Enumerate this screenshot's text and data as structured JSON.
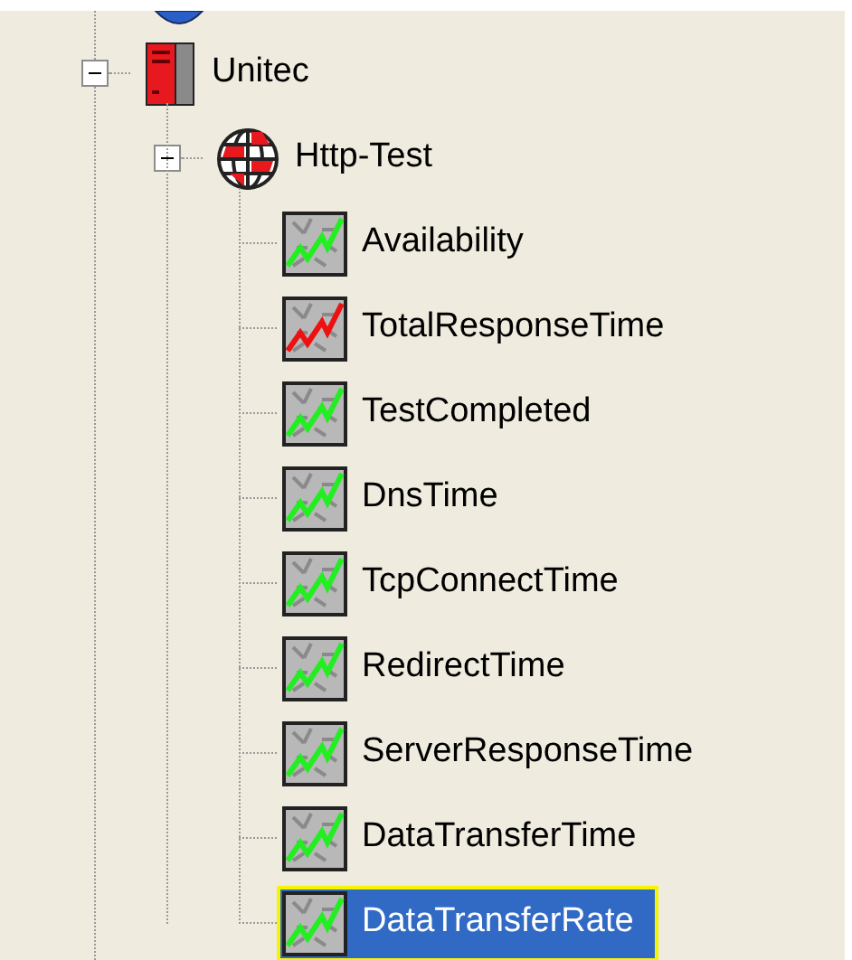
{
  "tree": [
    {
      "label": "Unitec",
      "kind": "server",
      "expanded": true,
      "children": [
        {
          "label": "Http-Test",
          "kind": "globe",
          "expanded": true,
          "children": [
            {
              "label": "Availability",
              "kind": "chart",
              "alert": false,
              "selected": false
            },
            {
              "label": "TotalResponseTime",
              "kind": "chart",
              "alert": true,
              "selected": false
            },
            {
              "label": "TestCompleted",
              "kind": "chart",
              "alert": false,
              "selected": false
            },
            {
              "label": "DnsTime",
              "kind": "chart",
              "alert": false,
              "selected": false
            },
            {
              "label": "TcpConnectTime",
              "kind": "chart",
              "alert": false,
              "selected": false
            },
            {
              "label": "RedirectTime",
              "kind": "chart",
              "alert": false,
              "selected": false
            },
            {
              "label": "ServerResponseTime",
              "kind": "chart",
              "alert": false,
              "selected": false
            },
            {
              "label": "DataTransferTime",
              "kind": "chart",
              "alert": false,
              "selected": false
            },
            {
              "label": "DataTransferRate",
              "kind": "chart",
              "alert": false,
              "selected": true
            }
          ]
        }
      ]
    }
  ]
}
